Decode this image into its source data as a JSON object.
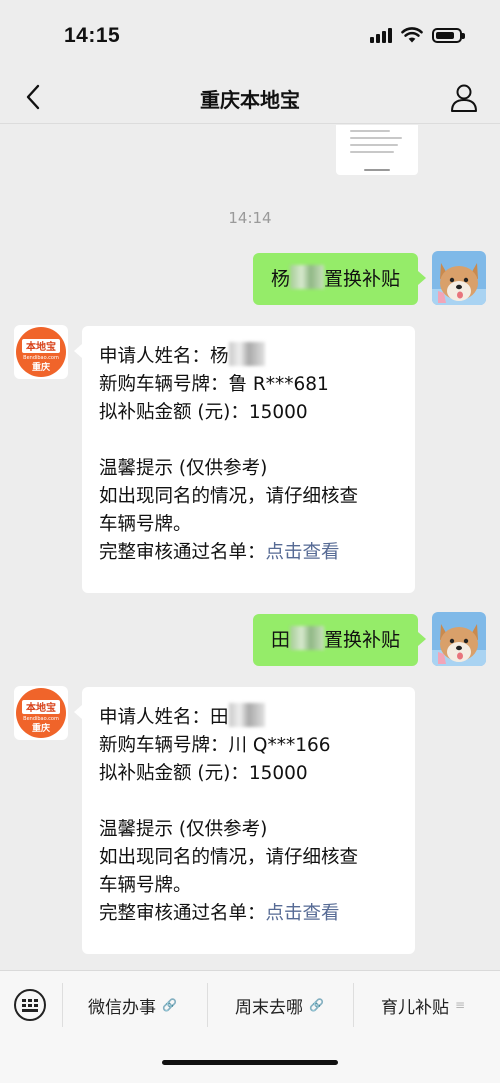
{
  "status": {
    "time": "14:15",
    "battery_level": 0.8
  },
  "nav": {
    "title": "重庆本地宝"
  },
  "chat": {
    "timestamp": "14:14",
    "messages": [
      {
        "from": "self",
        "text_prefix": "杨",
        "text_suffix": "置换补贴"
      },
      {
        "from": "bot",
        "name_label": "申请人姓名：",
        "name_value": "杨",
        "plate_label": "新购车辆号牌：",
        "plate_value": "鲁 R***681",
        "amount_label": "拟补贴金额 (元)：",
        "amount_value": "15000",
        "tip_title": "温馨提示 (仅供参考)",
        "tip_line1": "如出现同名的情况，请仔细核查",
        "tip_line2": "车辆号牌。",
        "list_label": "完整审核通过名单：",
        "list_link": "点击查看"
      },
      {
        "from": "self",
        "text_prefix": "田",
        "text_suffix": "置换补贴"
      },
      {
        "from": "bot",
        "name_label": "申请人姓名：",
        "name_value": "田",
        "plate_label": "新购车辆号牌：",
        "plate_value": "川 Q***166",
        "amount_label": "拟补贴金额 (元)：",
        "amount_value": "15000",
        "tip_title": "温馨提示 (仅供参考)",
        "tip_line1": "如出现同名的情况，请仔细核查",
        "tip_line2": "车辆号牌。",
        "list_label": "完整审核通过名单：",
        "list_link": "点击查看"
      }
    ]
  },
  "bot_logo": {
    "top": "本地宝",
    "sub": "Bendibao.com",
    "bottom": "重庆",
    "color": "#f0642a"
  },
  "bottom_menu": {
    "items": [
      {
        "label": "微信办事",
        "icon": "link-icon"
      },
      {
        "label": "周末去哪",
        "icon": "link-icon"
      },
      {
        "label": "育儿补贴",
        "icon": "menu-icon"
      }
    ]
  }
}
